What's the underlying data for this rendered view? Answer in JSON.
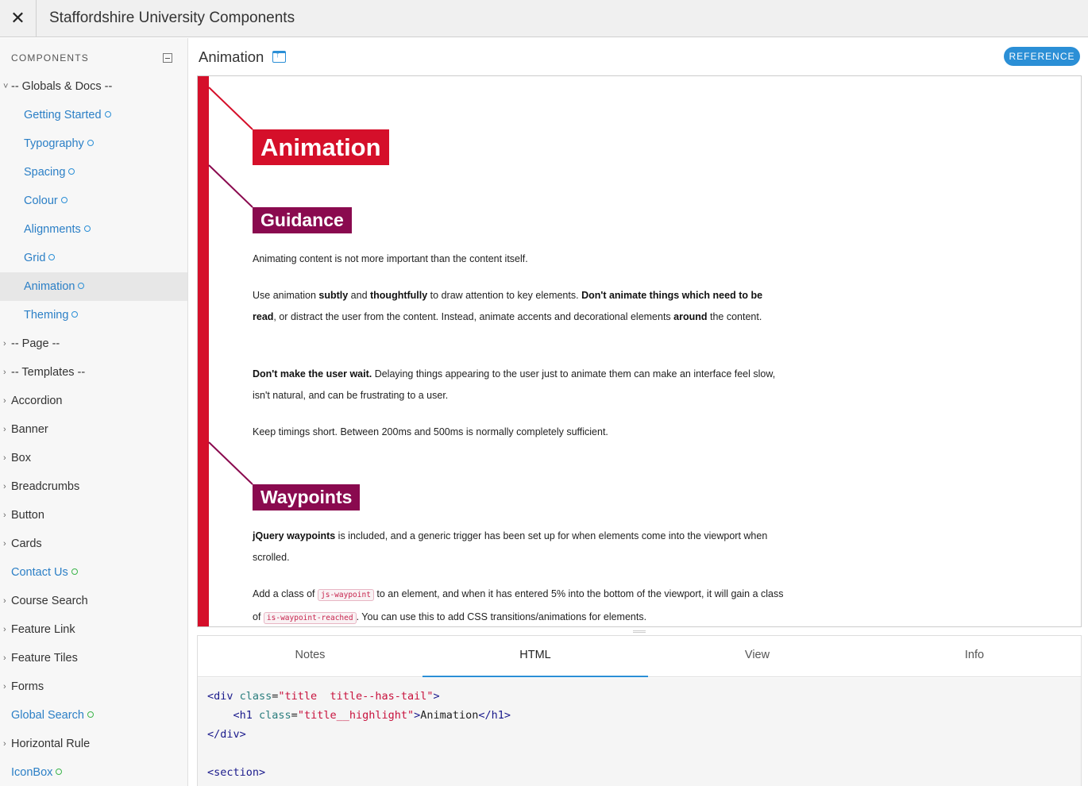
{
  "app": {
    "title": "Staffordshire University Components",
    "close_icon": "✕"
  },
  "sidebar": {
    "heading": "COMPONENTS",
    "items": [
      {
        "label": "-- Globals & Docs --",
        "caret": "˅",
        "type": "group"
      },
      {
        "label": "Getting Started",
        "type": "child"
      },
      {
        "label": "Typography",
        "type": "child"
      },
      {
        "label": "Spacing",
        "type": "child"
      },
      {
        "label": "Colour",
        "type": "child"
      },
      {
        "label": "Alignments",
        "type": "child"
      },
      {
        "label": "Grid",
        "type": "child"
      },
      {
        "label": "Animation",
        "type": "child",
        "selected": true
      },
      {
        "label": "Theming",
        "type": "child"
      },
      {
        "label": "-- Page --",
        "caret": "›",
        "type": "group"
      },
      {
        "label": "-- Templates --",
        "caret": "›",
        "type": "group"
      },
      {
        "label": "Accordion",
        "caret": "›",
        "type": "group"
      },
      {
        "label": "Banner",
        "caret": "›",
        "type": "group"
      },
      {
        "label": "Box",
        "caret": "›",
        "type": "group"
      },
      {
        "label": "Breadcrumbs",
        "caret": "›",
        "type": "group"
      },
      {
        "label": "Button",
        "caret": "›",
        "type": "group"
      },
      {
        "label": "Cards",
        "caret": "›",
        "type": "group"
      },
      {
        "label": "Contact Us",
        "type": "link"
      },
      {
        "label": "Course Search",
        "caret": "›",
        "type": "group"
      },
      {
        "label": "Feature Link",
        "caret": "›",
        "type": "group"
      },
      {
        "label": "Feature Tiles",
        "caret": "›",
        "type": "group"
      },
      {
        "label": "Forms",
        "caret": "›",
        "type": "group"
      },
      {
        "label": "Global Search",
        "type": "link"
      },
      {
        "label": "Horizontal Rule",
        "caret": "›",
        "type": "group"
      },
      {
        "label": "IconBox",
        "type": "link"
      }
    ]
  },
  "main": {
    "component_title": "Animation",
    "reference_label": "REFERENCE",
    "preview": {
      "title": "Animation",
      "guidance_heading": "Guidance",
      "p1": "Animating content is not more important than the content itself.",
      "p2": {
        "a": "Use animation ",
        "b": "subtly",
        "c": " and ",
        "d": "thoughtfully",
        "e": " to draw attention to key elements. ",
        "f": "Don't animate things which need to be read",
        "g": ", or distract the user from the content. Instead, animate accents and decorational elements ",
        "h": "around",
        "i": " the content."
      },
      "p3": {
        "a": "Don't make the user wait.",
        "b": " Delaying things appearing to the user just to animate them can make an interface feel slow, isn't natural, and can be frustrating to a user."
      },
      "p4": "Keep timings short. Between 200ms and 500ms is normally completely sufficient.",
      "waypoints_heading": "Waypoints",
      "p5": {
        "a": "jQuery waypoints",
        "b": " is included, and a generic trigger has been set up for when elements come into the viewport when scrolled."
      },
      "p6": {
        "a": "Add a class of ",
        "code1": "js-waypoint",
        "b": " to an element, and when it has entered 5% into the bottom of the viewport, it will gain a class of ",
        "code2": "is-waypoint-reached",
        "c": ". You can use this to add CSS transitions/animations for elements."
      }
    },
    "tabs": [
      "Notes",
      "HTML",
      "View",
      "Info"
    ],
    "active_tab": "HTML",
    "code": {
      "l1_open": "<div ",
      "l1_attr": "class",
      "l1_eq": "=",
      "l1_val": "\"title  title--has-tail\"",
      "l1_close": ">",
      "l2_open": "<h1 ",
      "l2_attr": "class",
      "l2_eq": "=",
      "l2_val": "\"title__highlight\"",
      "l2_close": ">",
      "l2_text": "Animation",
      "l2_end": "</h1>",
      "l3": "</div>",
      "l5": "<section>"
    }
  },
  "colors": {
    "accent": "#2b8fd6",
    "brand_red": "#d50f2a",
    "brand_purple": "#8a0a4f"
  }
}
